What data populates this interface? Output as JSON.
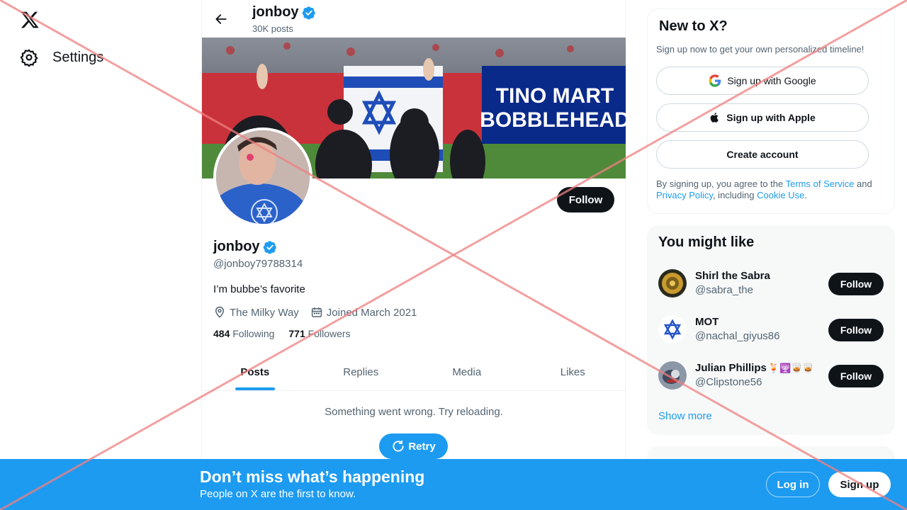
{
  "nav": {
    "settings_label": "Settings"
  },
  "topbar": {
    "name": "jonboy",
    "posts": "30K posts"
  },
  "banner": {
    "sign_line1": "TINO MART",
    "sign_line2": "BOBBLEHEAD"
  },
  "profile": {
    "follow_label": "Follow",
    "name": "jonboy",
    "handle": "@jonboy79788314",
    "bio": "I’m bubbe’s favorite",
    "location": "The Milky Way",
    "joined": "Joined March 2021",
    "following_count": "484",
    "following_label": "Following",
    "followers_count": "771",
    "followers_label": "Followers"
  },
  "tabs": [
    {
      "label": "Posts"
    },
    {
      "label": "Replies"
    },
    {
      "label": "Media"
    },
    {
      "label": "Likes"
    }
  ],
  "feed": {
    "error": "Something went wrong. Try reloading.",
    "retry_label": "Retry"
  },
  "signup_card": {
    "title": "New to X?",
    "subtitle": "Sign up now to get your own personalized timeline!",
    "google_label": "Sign up with Google",
    "apple_label": "Sign up with Apple",
    "create_label": "Create account",
    "terms_prefix": "By signing up, you agree to the ",
    "terms_link": "Terms of Service",
    "terms_and": " and ",
    "privacy_link": "Privacy Policy",
    "terms_including": ", including ",
    "cookie_link": "Cookie Use",
    "terms_end": "."
  },
  "suggestions": {
    "title": "You might like",
    "items": [
      {
        "name": "Shirl the Sabra",
        "handle": "@sabra_the",
        "follow": "Follow",
        "emoji": ""
      },
      {
        "name": "MOT",
        "handle": "@nachal_giyus86",
        "follow": "Follow",
        "emoji": ""
      },
      {
        "name": "Julian Phillips",
        "handle": "@Clipstone56",
        "follow": "Follow",
        "emoji": "🍹🕎🥃🥃"
      }
    ],
    "show_more": "Show more"
  },
  "bottombar": {
    "title": "Don’t miss what’s happening",
    "subtitle": "People on X are the first to know.",
    "login_label": "Log in",
    "signup_label": "Sign up"
  },
  "colors": {
    "accent": "#1d9bf0",
    "text": "#0f1419",
    "muted": "#536471",
    "overlay": "#f08080"
  }
}
